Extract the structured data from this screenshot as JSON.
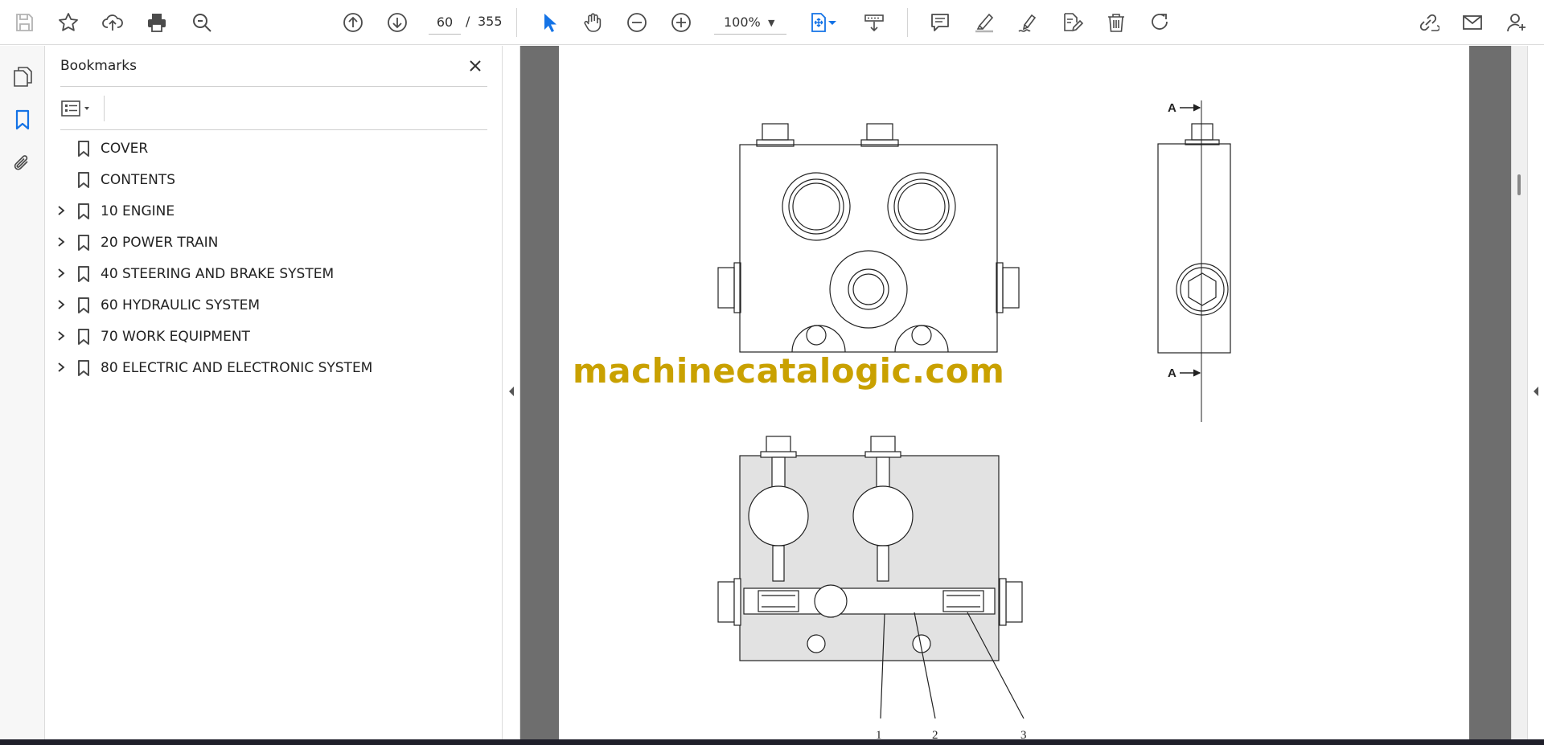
{
  "toolbar": {
    "current_page": "60",
    "page_separator": "/",
    "total_pages": "355",
    "zoom": "100%"
  },
  "bookmarks_panel": {
    "title": "Bookmarks",
    "items": [
      {
        "label": "COVER",
        "expandable": false
      },
      {
        "label": "CONTENTS",
        "expandable": false
      },
      {
        "label": "10 ENGINE",
        "expandable": true
      },
      {
        "label": "20 POWER TRAIN",
        "expandable": true
      },
      {
        "label": "40 STEERING AND BRAKE SYSTEM",
        "expandable": true
      },
      {
        "label": "60 HYDRAULIC SYSTEM",
        "expandable": true
      },
      {
        "label": "70 WORK EQUIPMENT",
        "expandable": true
      },
      {
        "label": "80 ELECTRIC AND ELECTRONIC SYSTEM",
        "expandable": true
      }
    ]
  },
  "document": {
    "watermark": "machinecatalogic.com",
    "section_label_top": "A",
    "section_label_bottom": "A",
    "callouts": [
      "1",
      "2",
      "3"
    ]
  },
  "colors": {
    "accent_blue": "#1473e6",
    "icon_gray": "#4b4b4b",
    "watermark": "#c9a100",
    "viewer_bg": "#6e6e6e"
  }
}
